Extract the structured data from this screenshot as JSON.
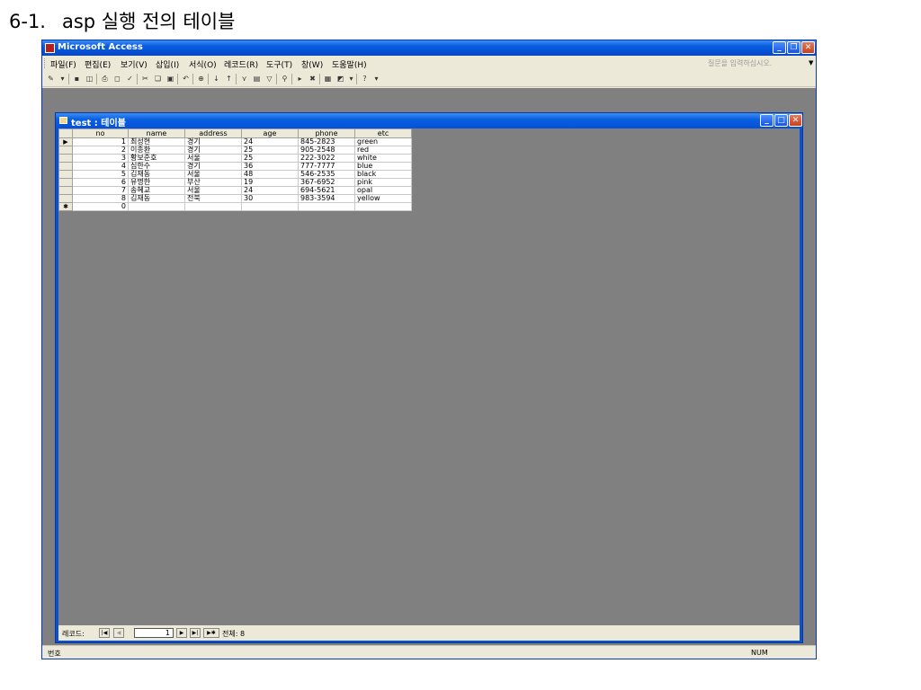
{
  "heading": {
    "number": "6-1.",
    "text": "asp 실행 전의 테이블"
  },
  "app": {
    "title": "Microsoft Access",
    "menu": [
      "파일(F)",
      "편집(E)",
      "보기(V)",
      "삽입(I)",
      "서식(O)",
      "레코드(R)",
      "도구(T)",
      "창(W)",
      "도움말(H)"
    ],
    "help_placeholder": "질문을 입력하십시오.",
    "accent": "#0a5fe0"
  },
  "table_window": {
    "title": "test : 테이블",
    "columns": [
      "no",
      "name",
      "address",
      "age",
      "phone",
      "etc"
    ],
    "rows": [
      [
        "1",
        "최성현",
        "경기",
        "24",
        "845-2823",
        "green"
      ],
      [
        "2",
        "이종환",
        "경기",
        "25",
        "905-2548",
        "red"
      ],
      [
        "3",
        "황보준호",
        "서울",
        "25",
        "222-3022",
        "white"
      ],
      [
        "4",
        "심한수",
        "경기",
        "36",
        "777-7777",
        "blue"
      ],
      [
        "5",
        "김재동",
        "서울",
        "48",
        "546-2535",
        "black"
      ],
      [
        "6",
        "유명한",
        "부산",
        "19",
        "367-6952",
        "pink"
      ],
      [
        "7",
        "송혜교",
        "서울",
        "24",
        "694-5621",
        "opal"
      ],
      [
        "8",
        "김재동",
        "전북",
        "30",
        "983-3594",
        "yellow"
      ]
    ],
    "new_row_no": "0",
    "current_row_marker": "▶",
    "new_row_marker": "✱"
  },
  "navigator": {
    "label": "레코드:",
    "current": "1",
    "total": "전체: 8"
  },
  "status": {
    "left": "번호",
    "right": "NUM"
  }
}
